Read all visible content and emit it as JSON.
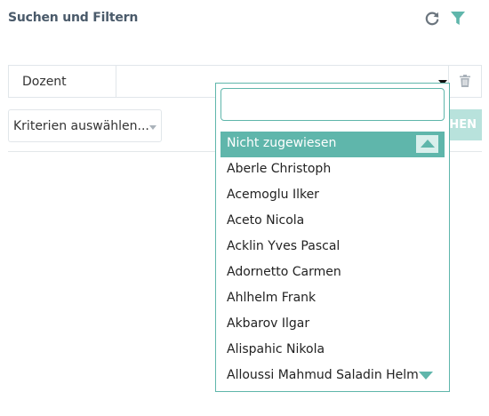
{
  "panel": {
    "title": "Suchen und Filtern",
    "icons": [
      "reload-icon",
      "filter-icon"
    ],
    "accent_color": "#5fb6ab"
  },
  "criteria_row": {
    "label": "Dozent",
    "trash_icon": "trash-icon"
  },
  "criteria_picker": {
    "label": "Kriterien auswählen..."
  },
  "search_button": {
    "label": "HEN"
  },
  "dropdown": {
    "search_value": "",
    "options": [
      "Nicht zugewiesen",
      "Aberle Christoph",
      "Acemoglu Ilker",
      "Aceto Nicola",
      "Acklin Yves Pascal",
      "Adornetto Carmen",
      "Ahlhelm Frank",
      "Akbarov Ilgar",
      "Alispahic Nikola",
      "Alloussi Mahmud Saladin Helmut"
    ],
    "highlighted_option": "Nicht zugewiesen"
  }
}
